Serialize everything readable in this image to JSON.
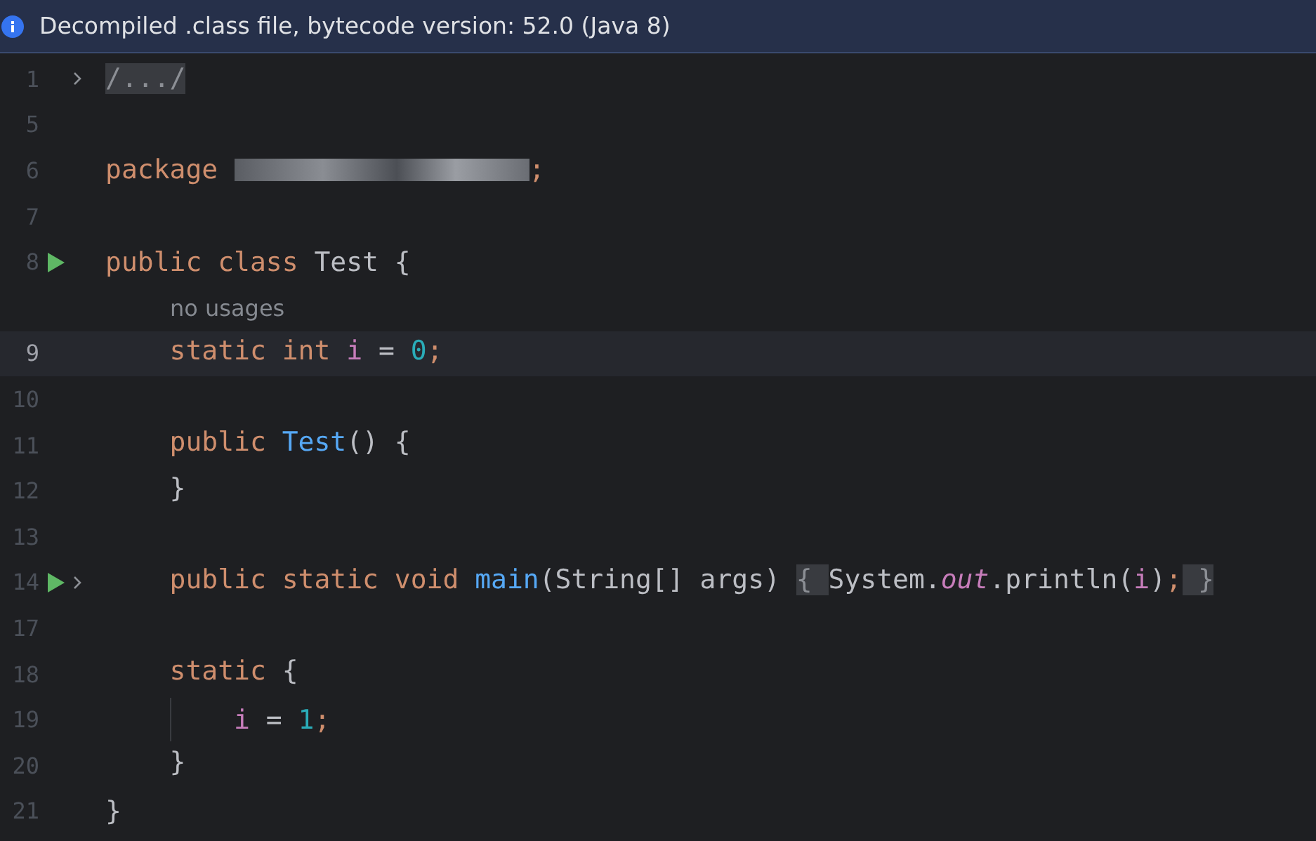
{
  "banner": {
    "text": "Decompiled .class file, bytecode version: 52.0 (Java 8)"
  },
  "lines": [
    {
      "kind": "code",
      "number": "1",
      "selected": false,
      "run": false,
      "foldable": true,
      "tokens": [
        {
          "kind": "folded",
          "text": "/.../"
        }
      ]
    },
    {
      "kind": "code",
      "number": "5",
      "selected": false,
      "run": false,
      "foldable": false
    },
    {
      "kind": "code",
      "number": "6",
      "selected": false,
      "run": false,
      "foldable": false,
      "tokens": [
        {
          "kind": "keyword",
          "text": "package "
        },
        {
          "kind": "redacted"
        },
        {
          "kind": "keyword",
          "text": ";"
        }
      ]
    },
    {
      "kind": "code",
      "number": "7",
      "selected": false,
      "run": false,
      "foldable": false
    },
    {
      "kind": "code",
      "number": "8",
      "selected": false,
      "run": true,
      "foldable": false,
      "tokens": [
        {
          "kind": "keyword",
          "text": "public class "
        },
        {
          "kind": "plain",
          "text": "Test {"
        }
      ]
    },
    {
      "kind": "hint",
      "text": "no usages"
    },
    {
      "kind": "code",
      "number": "9",
      "selected": true,
      "run": false,
      "foldable": false,
      "tokens": [
        {
          "kind": "indent"
        },
        {
          "kind": "keyword",
          "text": "static int "
        },
        {
          "kind": "field",
          "text": "i"
        },
        {
          "kind": "plain",
          "text": " = "
        },
        {
          "kind": "number",
          "text": "0"
        },
        {
          "kind": "keyword",
          "text": ";"
        }
      ]
    },
    {
      "kind": "code",
      "number": "10",
      "selected": false,
      "run": false,
      "foldable": false
    },
    {
      "kind": "code",
      "number": "11",
      "selected": false,
      "run": false,
      "foldable": false,
      "tokens": [
        {
          "kind": "indent"
        },
        {
          "kind": "keyword",
          "text": "public "
        },
        {
          "kind": "method",
          "text": "Test"
        },
        {
          "kind": "plain",
          "text": "() {"
        }
      ]
    },
    {
      "kind": "code",
      "number": "12",
      "selected": false,
      "run": false,
      "foldable": false,
      "tokens": [
        {
          "kind": "indent"
        },
        {
          "kind": "plain",
          "text": "}"
        }
      ]
    },
    {
      "kind": "code",
      "number": "13",
      "selected": false,
      "run": false,
      "foldable": false
    },
    {
      "kind": "code",
      "number": "14",
      "selected": false,
      "run": true,
      "foldable": true,
      "tokens": [
        {
          "kind": "indent"
        },
        {
          "kind": "keyword",
          "text": "public static void "
        },
        {
          "kind": "method",
          "text": "main"
        },
        {
          "kind": "plain",
          "text": "(String[] args) "
        },
        {
          "kind": "folded",
          "text": "{ "
        },
        {
          "kind": "plain",
          "text": "System."
        },
        {
          "kind": "static-field",
          "text": "out"
        },
        {
          "kind": "plain",
          "text": ".println("
        },
        {
          "kind": "field",
          "text": "i"
        },
        {
          "kind": "plain",
          "text": ")"
        },
        {
          "kind": "keyword",
          "text": ";"
        },
        {
          "kind": "folded",
          "text": " }"
        }
      ]
    },
    {
      "kind": "code",
      "number": "17",
      "selected": false,
      "run": false,
      "foldable": false
    },
    {
      "kind": "code",
      "number": "18",
      "selected": false,
      "run": false,
      "foldable": false,
      "tokens": [
        {
          "kind": "indent"
        },
        {
          "kind": "keyword",
          "text": "static "
        },
        {
          "kind": "plain",
          "text": "{"
        }
      ]
    },
    {
      "kind": "code",
      "number": "19",
      "selected": false,
      "run": false,
      "foldable": false,
      "tokens": [
        {
          "kind": "indent"
        },
        {
          "kind": "guide-indent"
        },
        {
          "kind": "field",
          "text": "i"
        },
        {
          "kind": "plain",
          "text": " = "
        },
        {
          "kind": "number",
          "text": "1"
        },
        {
          "kind": "keyword",
          "text": ";"
        }
      ]
    },
    {
      "kind": "code",
      "number": "20",
      "selected": false,
      "run": false,
      "foldable": false,
      "tokens": [
        {
          "kind": "indent"
        },
        {
          "kind": "plain",
          "text": "}"
        }
      ]
    },
    {
      "kind": "code",
      "number": "21",
      "selected": false,
      "run": false,
      "foldable": false,
      "tokens": [
        {
          "kind": "plain",
          "text": "}"
        }
      ]
    }
  ]
}
